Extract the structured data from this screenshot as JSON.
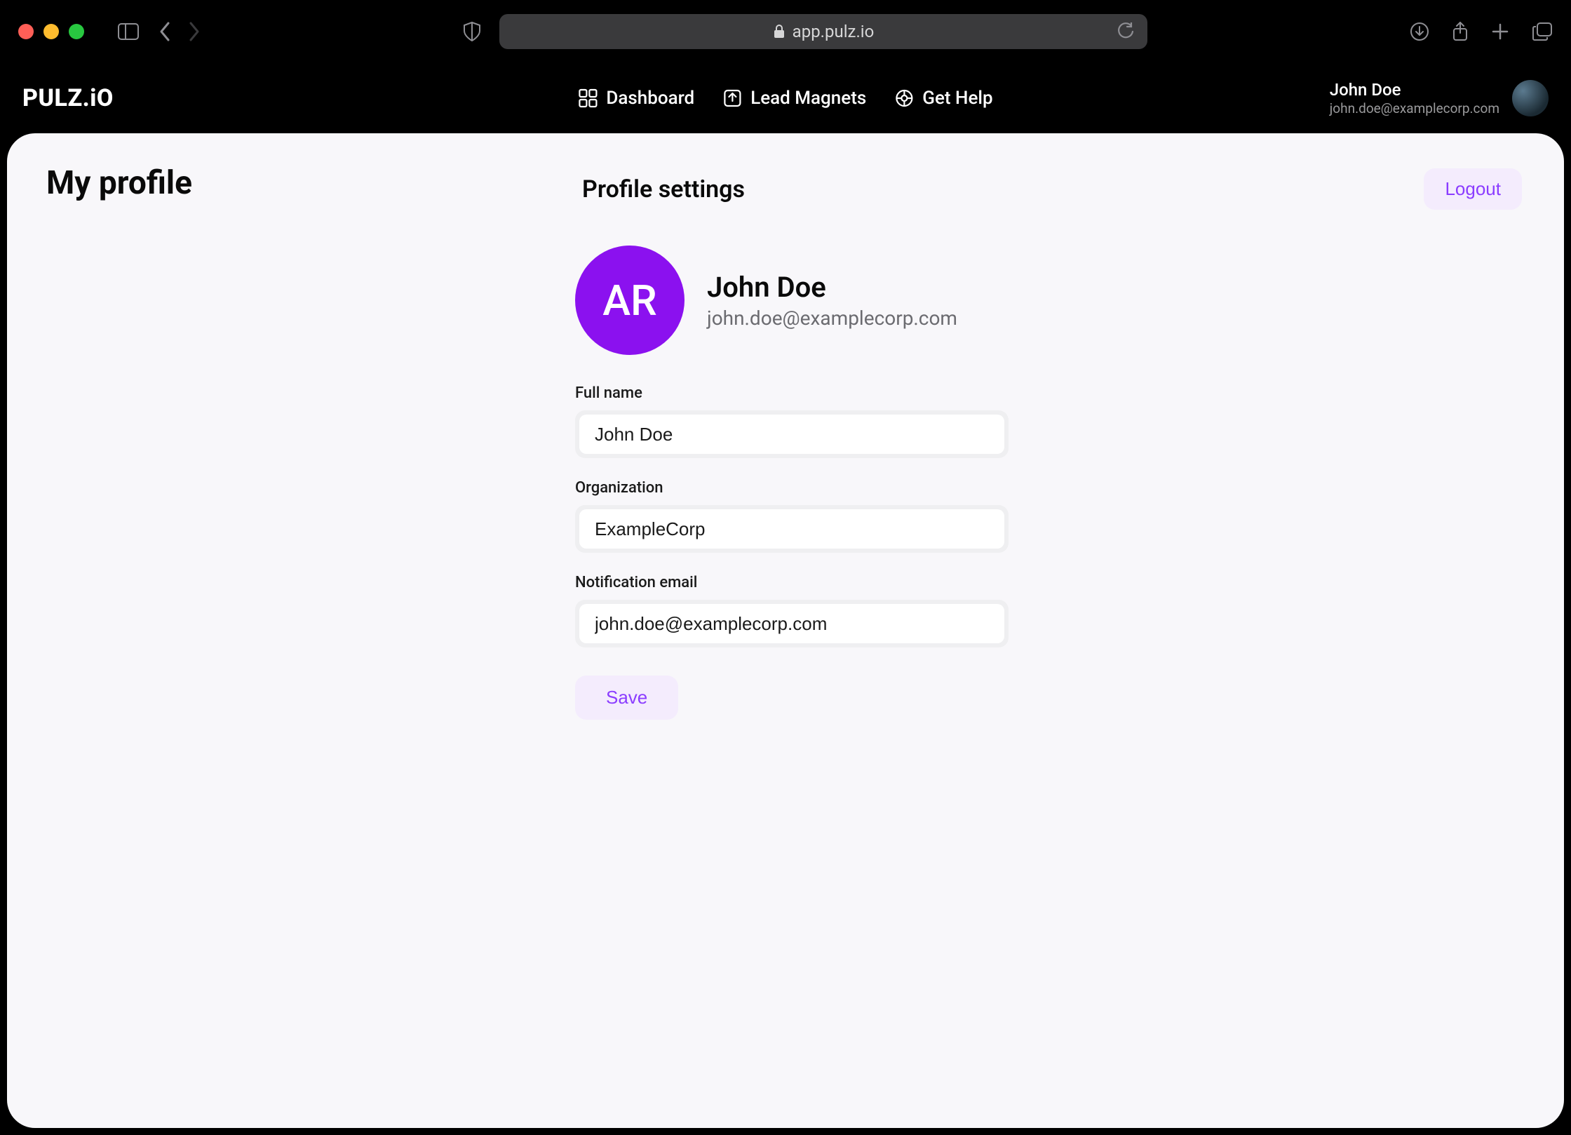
{
  "browser": {
    "url_display": "app.pulz.io"
  },
  "brand": "PULZ.iO",
  "nav": {
    "items": [
      {
        "label": "Dashboard"
      },
      {
        "label": "Lead Magnets"
      },
      {
        "label": "Get Help"
      }
    ]
  },
  "header_user": {
    "name": "John Doe",
    "email": "john.doe@examplecorp.com"
  },
  "page": {
    "title": "My profile",
    "section_title": "Profile settings",
    "logout_label": "Logout"
  },
  "profile": {
    "avatar_initials": "AR",
    "name": "John Doe",
    "email": "john.doe@examplecorp.com"
  },
  "form": {
    "fields": [
      {
        "label": "Full name",
        "value": "John Doe"
      },
      {
        "label": "Organization",
        "value": "ExampleCorp"
      },
      {
        "label": "Notification email",
        "value": "john.doe@examplecorp.com"
      }
    ],
    "save_label": "Save"
  },
  "colors": {
    "accent_purple": "#8b11ef",
    "accent_light": "#f4ecfd",
    "accent_text": "#8b3dff"
  }
}
